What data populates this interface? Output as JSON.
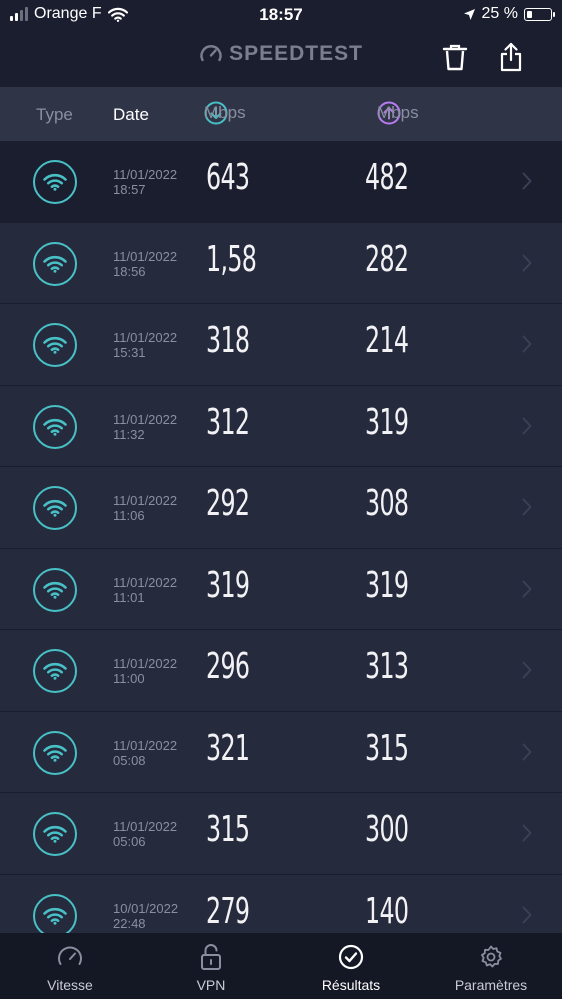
{
  "status_bar": {
    "carrier": "Orange F",
    "time": "18:57",
    "battery": "25 %",
    "battery_level": 0.25
  },
  "header": {
    "logo": "SPEEDTEST",
    "delete_icon": "trash-icon",
    "share_icon": "share-icon"
  },
  "columns": {
    "type": "Type",
    "date": "Date",
    "download_unit": "Mbps",
    "upload_unit": "Mbps"
  },
  "colors": {
    "download_accent": "#48c1c6",
    "upload_accent": "#b77cf2",
    "background": "#1b1e2e"
  },
  "results": [
    {
      "type": "wifi-icon",
      "date": "11/01/2022",
      "time": "18:57",
      "download": "643",
      "upload": "482"
    },
    {
      "type": "wifi-icon",
      "date": "11/01/2022",
      "time": "18:56",
      "download": "1,58",
      "upload": "282"
    },
    {
      "type": "wifi-icon",
      "date": "11/01/2022",
      "time": "15:31",
      "download": "318",
      "upload": "214"
    },
    {
      "type": "wifi-icon",
      "date": "11/01/2022",
      "time": "11:32",
      "download": "312",
      "upload": "319"
    },
    {
      "type": "wifi-icon",
      "date": "11/01/2022",
      "time": "11:06",
      "download": "292",
      "upload": "308"
    },
    {
      "type": "wifi-icon",
      "date": "11/01/2022",
      "time": "11:01",
      "download": "319",
      "upload": "319"
    },
    {
      "type": "wifi-icon",
      "date": "11/01/2022",
      "time": "11:00",
      "download": "296",
      "upload": "313"
    },
    {
      "type": "wifi-icon",
      "date": "11/01/2022",
      "time": "05:08",
      "download": "321",
      "upload": "315"
    },
    {
      "type": "wifi-icon",
      "date": "11/01/2022",
      "time": "05:06",
      "download": "315",
      "upload": "300"
    },
    {
      "type": "wifi-icon",
      "date": "10/01/2022",
      "time": "22:48",
      "download": "279",
      "upload": "140"
    }
  ],
  "tabs": [
    {
      "label": "Vitesse",
      "icon": "speedometer-icon"
    },
    {
      "label": "VPN",
      "icon": "lock-icon"
    },
    {
      "label": "Résultats",
      "icon": "checkmark-circle-icon",
      "active": true
    },
    {
      "label": "Paramètres",
      "icon": "gear-icon"
    }
  ]
}
